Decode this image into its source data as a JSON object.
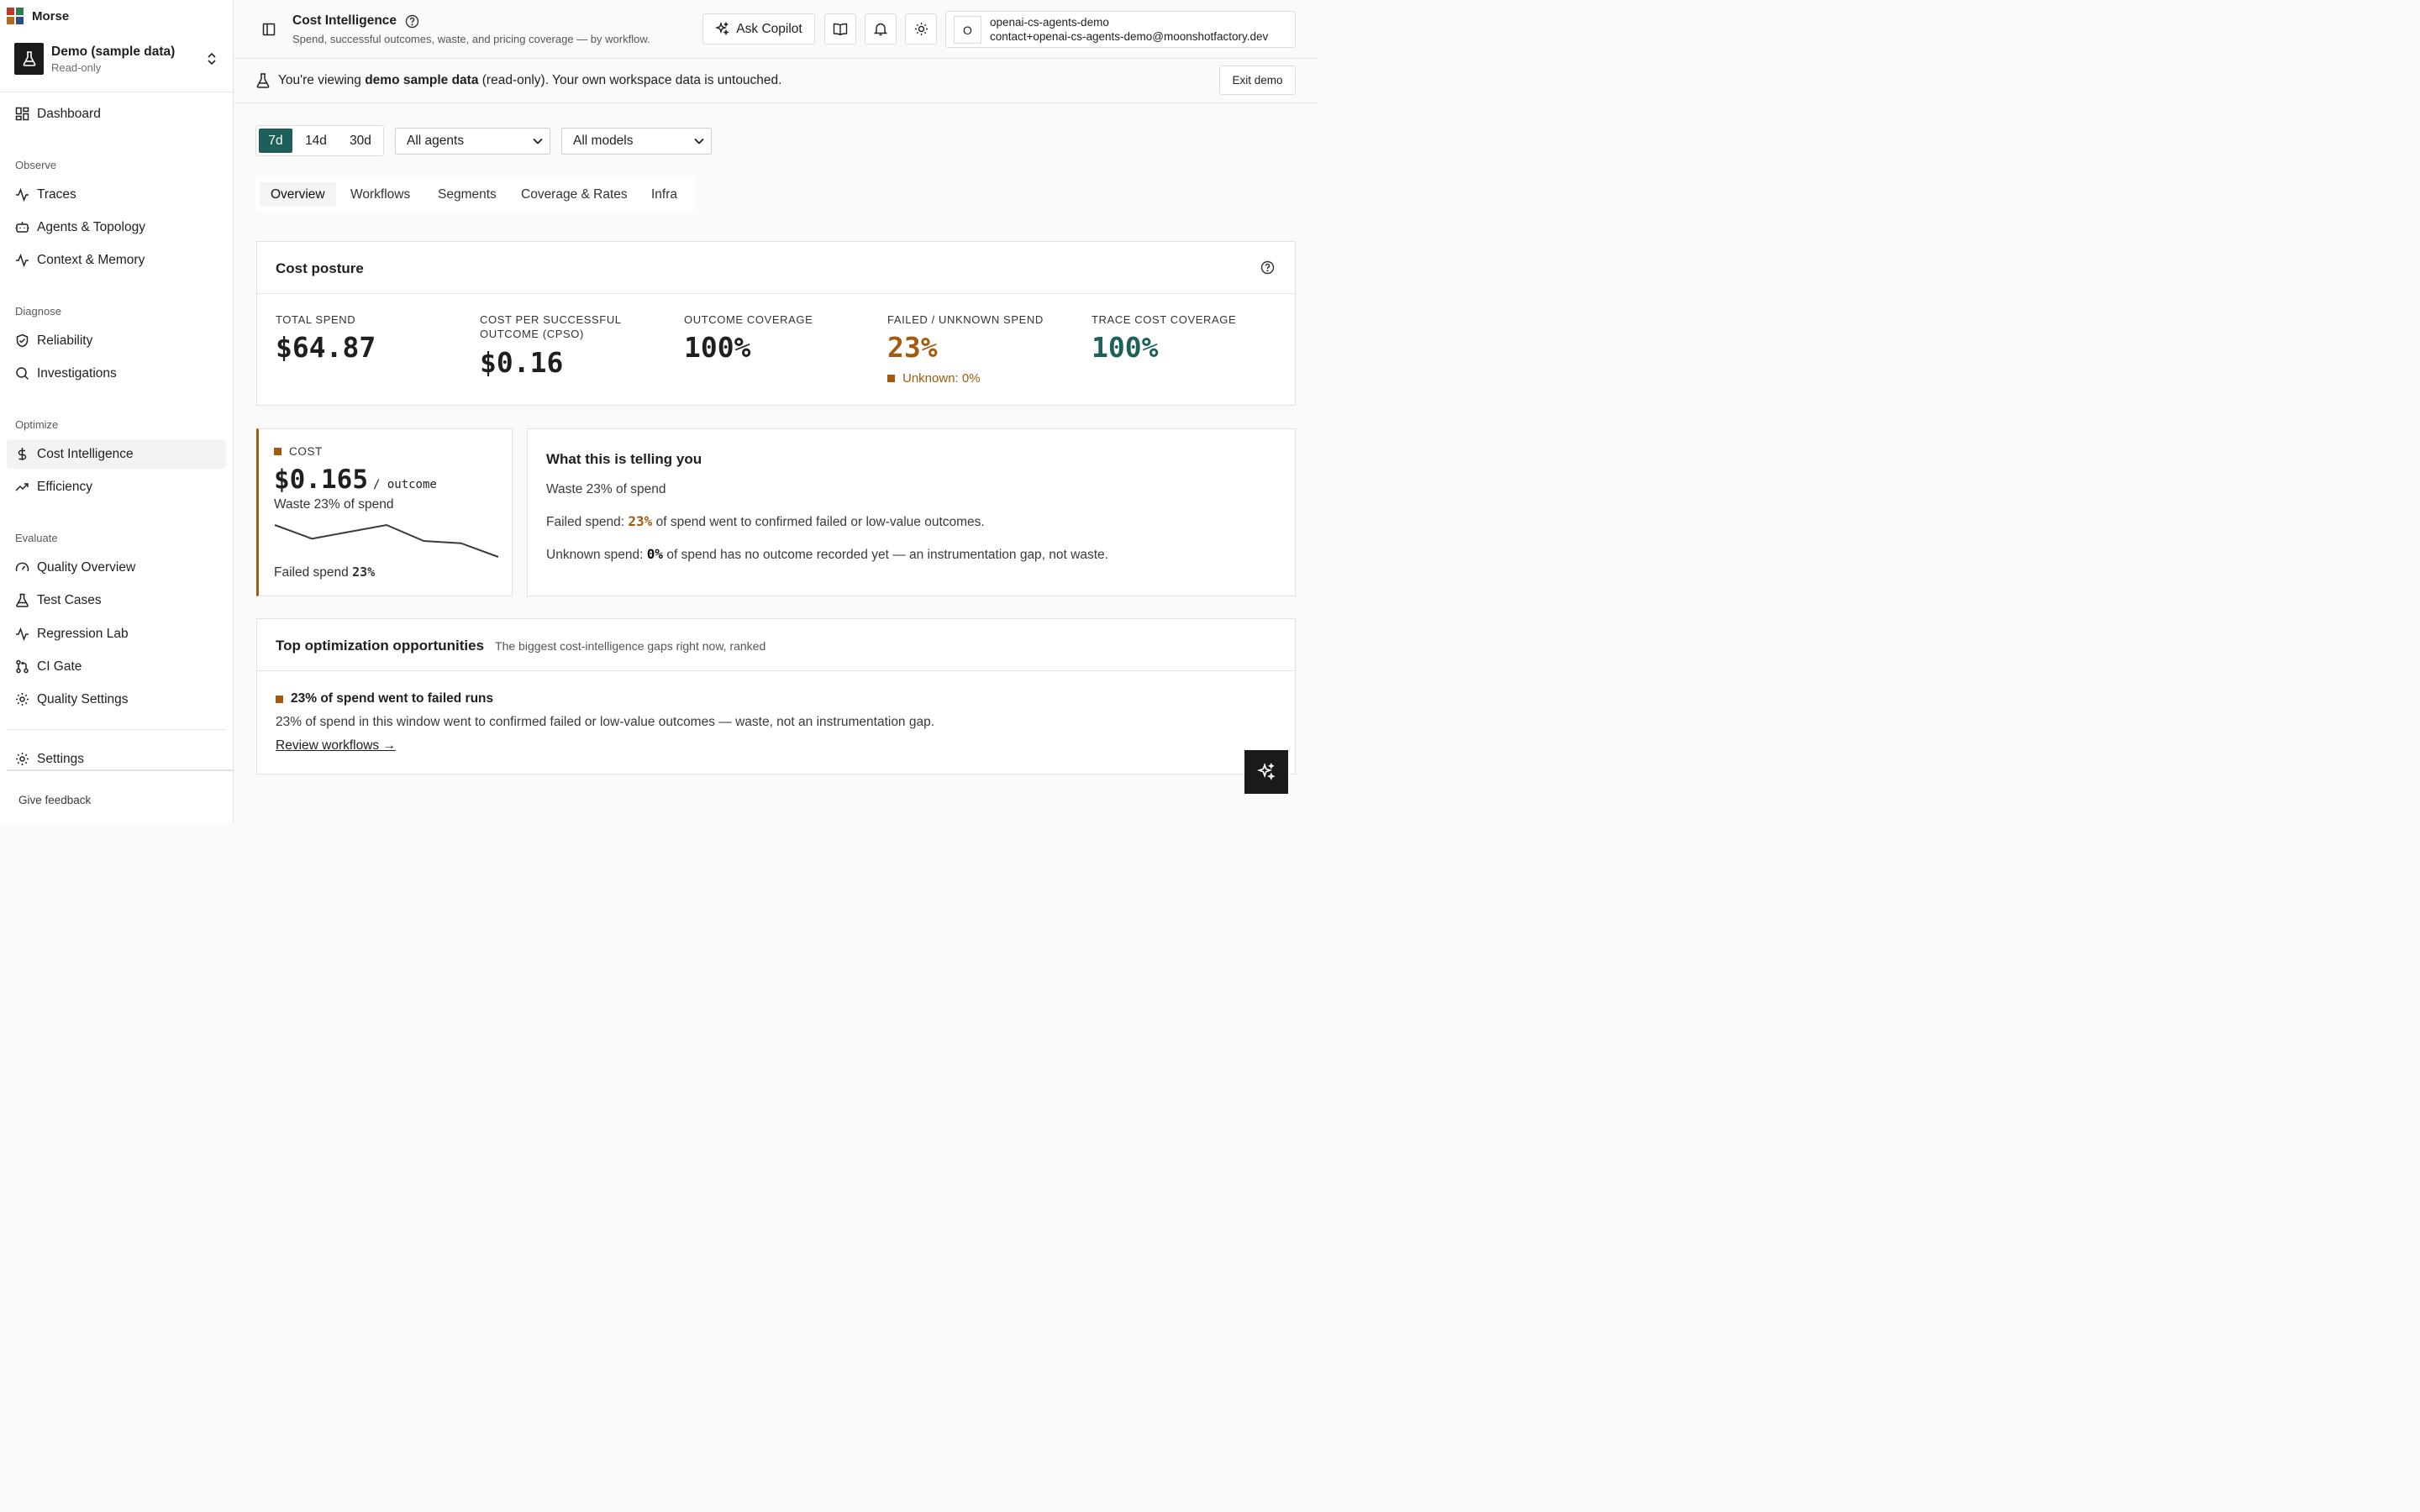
{
  "brand": {
    "name": "Morse",
    "logo_colors": [
      "#c0392b",
      "#2e7d4f",
      "#b26a1d",
      "#2b4e7a"
    ]
  },
  "workspace": {
    "name": "Demo (sample data)",
    "mode": "Read-only"
  },
  "nav": {
    "dashboard": "Dashboard",
    "sections": {
      "observe": "Observe",
      "diagnose": "Diagnose",
      "optimize": "Optimize",
      "evaluate": "Evaluate"
    },
    "traces": "Traces",
    "agents": "Agents & Topology",
    "context": "Context & Memory",
    "reliability": "Reliability",
    "investigations": "Investigations",
    "cost": "Cost Intelligence",
    "efficiency": "Efficiency",
    "quality_overview": "Quality Overview",
    "test_cases": "Test Cases",
    "regression_lab": "Regression Lab",
    "ci_gate": "CI Gate",
    "quality_settings": "Quality Settings",
    "settings": "Settings",
    "feedback": "Give feedback"
  },
  "header": {
    "title": "Cost Intelligence",
    "subtitle": "Spend, successful outcomes, waste, and pricing coverage — by workflow.",
    "copilot_label": "Ask Copilot",
    "user_initial": "O",
    "org": "openai-cs-agents-demo",
    "email": "contact+openai-cs-agents-demo@moonshotfactory.dev"
  },
  "banner": {
    "prefix": "You're viewing ",
    "bold": "demo sample data",
    "suffix": " (read-only). Your own workspace data is untouched.",
    "exit_label": "Exit demo"
  },
  "filters": {
    "ranges": [
      "7d",
      "14d",
      "30d"
    ],
    "selected_range": "7d",
    "agent_select": "All agents",
    "model_select": "All models"
  },
  "tabs": [
    "Overview",
    "Workflows",
    "Segments",
    "Coverage & Rates",
    "Infra"
  ],
  "posture": {
    "title": "Cost posture",
    "kpis": [
      {
        "label": "TOTAL SPEND",
        "value": "$64.87"
      },
      {
        "label_line1": "COST PER SUCCESSFUL",
        "label_line2": "OUTCOME (CPSO)",
        "value": "$0.16"
      },
      {
        "label": "OUTCOME COVERAGE",
        "value": "100%"
      },
      {
        "label": "FAILED / UNKNOWN SPEND",
        "value": "23%",
        "note": "Unknown: 0%"
      },
      {
        "label": "TRACE COST COVERAGE",
        "value": "100%"
      }
    ]
  },
  "cost_card": {
    "label": "COST",
    "value": "$0.165",
    "unit": "/ outcome",
    "waste": "Waste 23% of spend",
    "failed_prefix": "Failed spend ",
    "failed_value": "23%",
    "sparkline": [
      0.167,
      0.164,
      0.1655,
      0.167,
      0.1635,
      0.163,
      0.16
    ]
  },
  "insights": {
    "title": "What this is telling you",
    "waste": "Waste 23% of spend",
    "failed_prefix": "Failed spend: ",
    "failed_value": "23%",
    "failed_suffix": " of spend went to confirmed failed or low-value outcomes.",
    "unknown_prefix": "Unknown spend: ",
    "unknown_value": "0%",
    "unknown_suffix": " of spend has no outcome recorded yet — an instrumentation gap, not waste."
  },
  "opportunities": {
    "title": "Top optimization opportunities",
    "subtitle": "The biggest cost-intelligence gaps right now, ranked",
    "item_title": "23% of spend went to failed runs",
    "item_desc": "23% of spend in this window went to confirmed failed or low-value outcomes — waste, not an instrumentation gap.",
    "link": "Review workflows →"
  },
  "colors": {
    "accent": "#1d5f59",
    "amber": "#a35a0c"
  }
}
